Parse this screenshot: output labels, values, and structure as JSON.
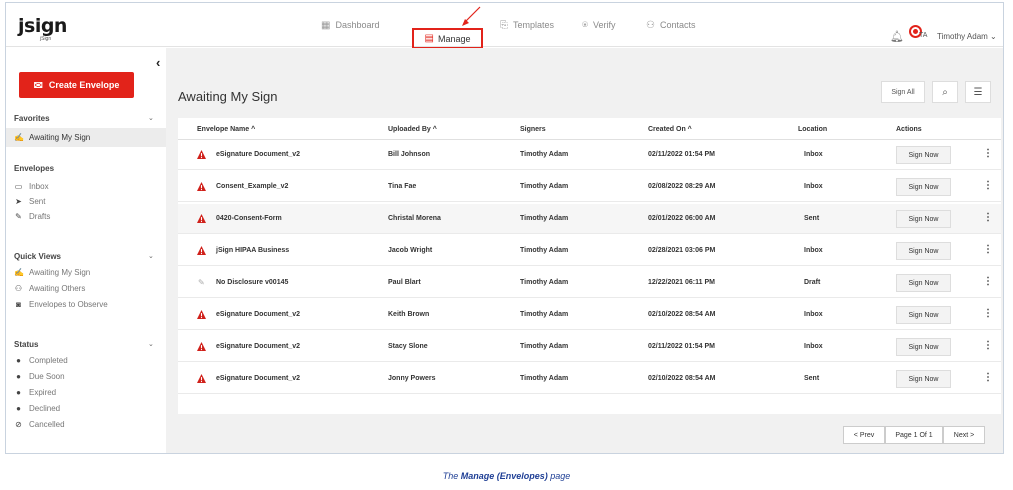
{
  "header": {
    "logo": "jsign",
    "logo_sub": "jSign",
    "nav": [
      {
        "label": "Dashboard",
        "icon": "grid-icon"
      },
      {
        "label": "Manage",
        "icon": "document-icon"
      },
      {
        "label": "Templates",
        "icon": "template-icon"
      },
      {
        "label": "Verify",
        "icon": "verify-icon"
      },
      {
        "label": "Contacts",
        "icon": "contacts-icon"
      }
    ],
    "user_initials": "TA",
    "user_name": "Timothy Adam ⌄"
  },
  "sidebar": {
    "create_label": "Create Envelope",
    "favorites": {
      "title": "Favorites",
      "items": [
        "Awaiting My Sign"
      ]
    },
    "envelopes": {
      "title": "Envelopes",
      "items": [
        "Inbox",
        "Sent",
        "Drafts"
      ]
    },
    "quick_views": {
      "title": "Quick Views",
      "items": [
        "Awaiting My Sign",
        "Awaiting Others",
        "Envelopes to Observe"
      ]
    },
    "status": {
      "title": "Status",
      "items": [
        "Completed",
        "Due Soon",
        "Expired",
        "Declined",
        "Cancelled"
      ]
    }
  },
  "main": {
    "title": "Awaiting My Sign",
    "sign_all": "Sign All",
    "columns": [
      "Envelope Name ^",
      "Uploaded By ^",
      "Signers",
      "Created On ^",
      "Location",
      "Actions"
    ],
    "rows": [
      {
        "name": "eSignature Document_v2",
        "uploaded_by": "Bill Johnson",
        "signers": "Timothy Adam",
        "created": "02/11/2022 01:54 PM",
        "location": "Inbox",
        "action": "Sign Now",
        "kind": "warn"
      },
      {
        "name": "Consent_Example_v2",
        "uploaded_by": "Tina Fae",
        "signers": "Timothy Adam",
        "created": "02/08/2022 08:29 AM",
        "location": "Inbox",
        "action": "Sign Now",
        "kind": "warn"
      },
      {
        "name": "0420-Consent-Form",
        "uploaded_by": "Christal Morena",
        "signers": "Timothy Adam",
        "created": "02/01/2022 06:00 AM",
        "location": "Sent",
        "action": "Sign Now",
        "kind": "warn"
      },
      {
        "name": "jSign HIPAA Business",
        "uploaded_by": "Jacob Wright",
        "signers": "Timothy Adam",
        "created": "02/28/2021 03:06 PM",
        "location": "Inbox",
        "action": "Sign Now",
        "kind": "warn"
      },
      {
        "name": "No Disclosure v00145",
        "uploaded_by": "Paul Blart",
        "signers": "Timothy Adam",
        "created": "12/22/2021 06:11 PM",
        "location": "Draft",
        "action": "Sign Now",
        "kind": "draft"
      },
      {
        "name": "eSignature Document_v2",
        "uploaded_by": "Keith Brown",
        "signers": "Timothy Adam",
        "created": "02/10/2022 08:54 AM",
        "location": "Inbox",
        "action": "Sign Now",
        "kind": "warn"
      },
      {
        "name": "eSignature Document_v2",
        "uploaded_by": "Stacy Slone",
        "signers": "Timothy Adam",
        "created": "02/11/2022 01:54 PM",
        "location": "Inbox",
        "action": "Sign Now",
        "kind": "warn"
      },
      {
        "name": "eSignature Document_v2",
        "uploaded_by": "Jonny Powers",
        "signers": "Timothy Adam",
        "created": "02/10/2022 08:54 AM",
        "location": "Sent",
        "action": "Sign Now",
        "kind": "warn"
      }
    ],
    "pager": {
      "prev": "< Prev",
      "page": "Page 1 Of 1",
      "next": "Next >"
    }
  },
  "caption": {
    "pre": "The ",
    "bold": "Manage (Envelopes)",
    "post": " page"
  },
  "colors": {
    "accent": "#e2231a",
    "caption": "#1f3f95"
  }
}
